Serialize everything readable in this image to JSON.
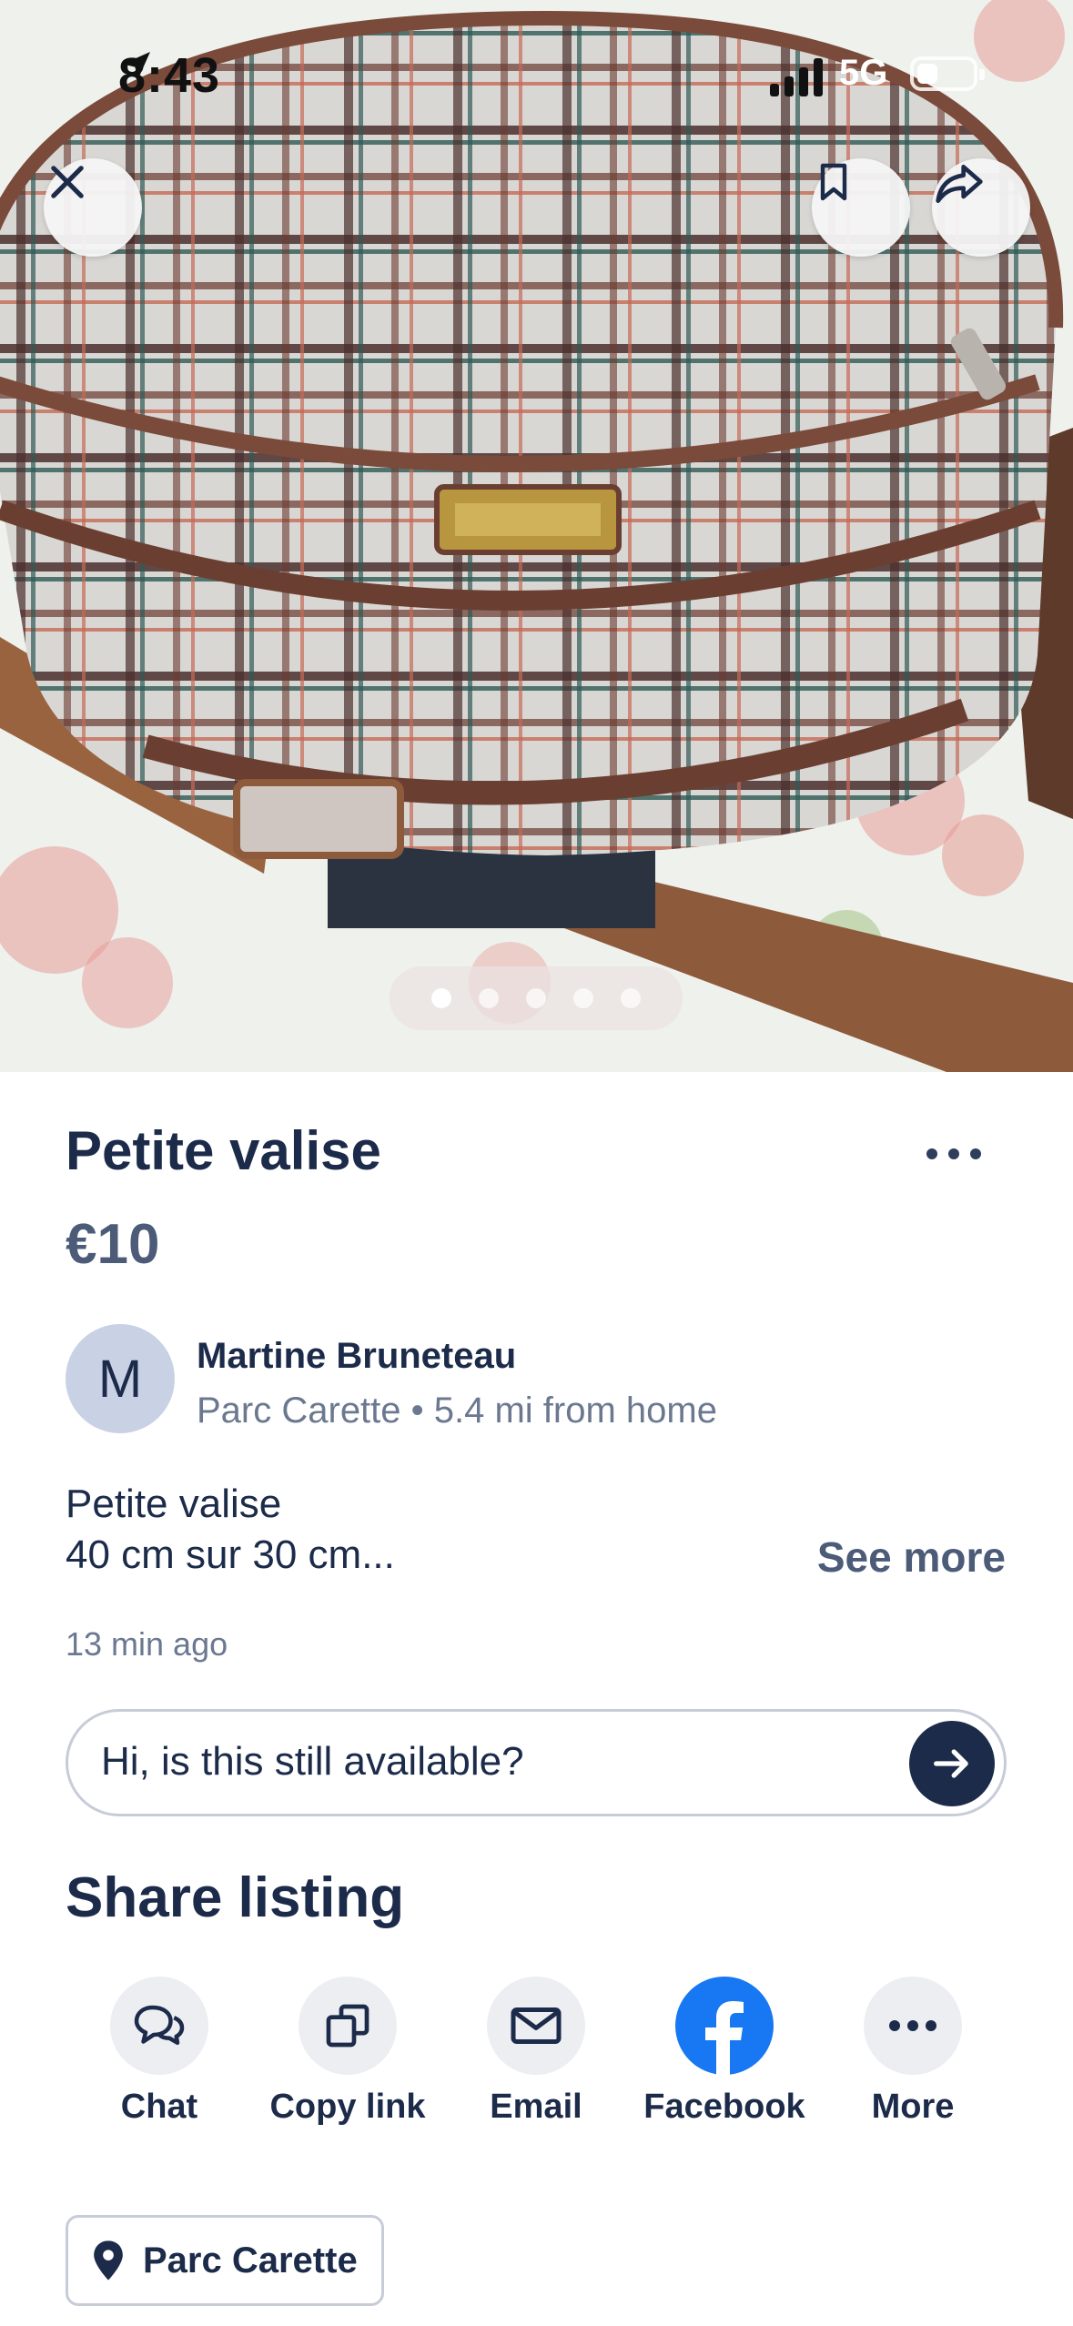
{
  "status_bar": {
    "time": "8:43",
    "network": "5G"
  },
  "listing": {
    "title": "Petite valise",
    "price": "€10",
    "photo_count": 5,
    "active_photo": 1
  },
  "seller": {
    "initial": "M",
    "name": "Martine Bruneteau",
    "location": "Parc Carette • 5.4 mi from home"
  },
  "description": {
    "line1": "Petite valise",
    "line2": "40 cm sur 30 cm...",
    "see_more": "See more"
  },
  "posted": "13 min ago",
  "message": {
    "text": "Hi, is this still available?"
  },
  "share": {
    "title": "Share listing",
    "items": [
      {
        "label": "Chat",
        "icon": "chat-bubbles-icon"
      },
      {
        "label": "Copy link",
        "icon": "copy-icon"
      },
      {
        "label": "Email",
        "icon": "envelope-icon"
      },
      {
        "label": "Facebook",
        "icon": "facebook-icon"
      },
      {
        "label": "More",
        "icon": "ellipsis-icon"
      }
    ]
  },
  "location_chip": {
    "label": "Parc Carette",
    "icon": "map-pin-icon"
  },
  "colors": {
    "primary_text": "#1c2b4a",
    "secondary_text": "#6b7890",
    "facebook_blue": "#1877f2"
  }
}
